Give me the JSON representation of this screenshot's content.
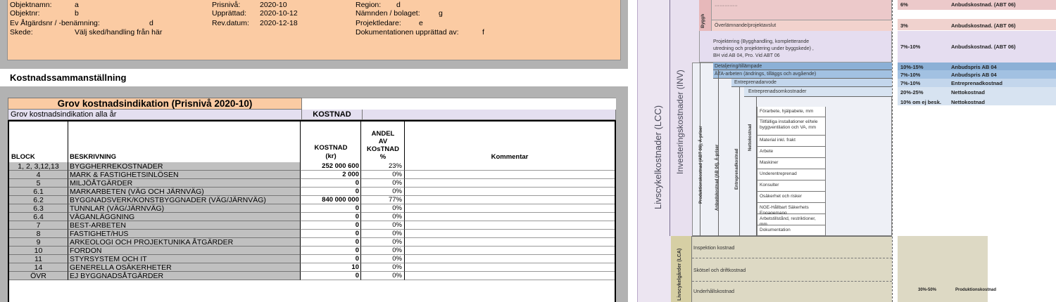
{
  "info": {
    "objektnamn": {
      "label": "Objektnamn:",
      "value": "a"
    },
    "objektnr": {
      "label": "Objektnr:",
      "value": "b"
    },
    "atgardsnr": {
      "label": "Ev Åtgärdsnr / -benämning:",
      "value": "d"
    },
    "skede": {
      "label": "Skede:",
      "value": "Välj sked/handling från här"
    },
    "prisniva": {
      "label": "Prisnivå:",
      "value": "2020-10"
    },
    "upprattad": {
      "label": "Upprättad:",
      "value": "2020-10-12"
    },
    "revdatum": {
      "label": "Rev.datum:",
      "value": "2020-12-18"
    },
    "region": {
      "label": "Region:",
      "value": "d"
    },
    "namnden": {
      "label": "Nämnden / bolaget:",
      "value": "g"
    },
    "projektledare": {
      "label": "Projektledare:",
      "value": "e"
    },
    "dokumentation": {
      "label": "Dokumentationen upprättad av:",
      "value": "f"
    }
  },
  "summary_title": "Kostnadssammanställning",
  "table": {
    "title": "Grov kostnadsindikation  (Prisnivå 2020-10)",
    "subtitle": "Grov kostnadsindikation alla år",
    "kostnad_header": "KOSTNAD",
    "headers": {
      "block": "BLOCK",
      "beskrivning": "BESKRIVNING",
      "kostnad": "KOSTNAD\n(kr)",
      "andel": "ANDEL\nAV\nKOsTNAD\n%",
      "kommentar": "Kommentar"
    },
    "rows": [
      {
        "block": "1, 2, 3,12,13",
        "desc": "BYGGHERREKOSTNADER",
        "cost": "252 000 600",
        "pct": "23%"
      },
      {
        "block": "4",
        "desc": "MARK & FASTIGHETSINLÖSEN",
        "cost": "2 000",
        "pct": "0%"
      },
      {
        "block": "5",
        "desc": "MILJÖÅTGÄRDER",
        "cost": "0",
        "pct": "0%"
      },
      {
        "block": "6.1",
        "desc": "MARKARBETEN (VÄG OCH JÄRNVÄG)",
        "cost": "0",
        "pct": "0%"
      },
      {
        "block": "6.2",
        "desc": "BYGGNADSVERK/KONSTBYGGNADER (VÄG/JÄRNVÄG)",
        "cost": "840 000 000",
        "pct": "77%"
      },
      {
        "block": "6.3",
        "desc": "TUNNLAR (VÄG/JÄRNVÄG)",
        "cost": "0",
        "pct": "0%"
      },
      {
        "block": "6.4",
        "desc": "VÄGANLÄGGNING",
        "cost": "0",
        "pct": "0%"
      },
      {
        "block": "7",
        "desc": "BEST-ARBETEN",
        "cost": "0",
        "pct": "0%"
      },
      {
        "block": "8",
        "desc": "FASTIGHET/HUS",
        "cost": "0",
        "pct": "0%"
      },
      {
        "block": "9",
        "desc": "ARKEOLOGI OCH PROJEKTUNIKA ÅTGÄRDER",
        "cost": "0",
        "pct": "0%"
      },
      {
        "block": "10",
        "desc": "FORDON",
        "cost": "0",
        "pct": "0%"
      },
      {
        "block": "11",
        "desc": "STYRSYSTEM OCH IT",
        "cost": "0",
        "pct": "0%"
      },
      {
        "block": "14",
        "desc": "GENERELLA OSÄKERHETER",
        "cost": "10",
        "pct": "0%"
      },
      {
        "block": "ÖVR",
        "desc": "EJ BYGGNADSÅTGÄRDER",
        "cost": "0",
        "pct": "0%"
      }
    ]
  },
  "diagram": {
    "lcc_label": "Livscykelkostnader (LCC)",
    "inv_label": "Investeringskostnader (INV)",
    "byggh_label": "Byggh",
    "lca_label": "Livscykelgårder (LCA)",
    "produktionskostnad_label": "Produktionskostnad (ABT 06), Á-priser",
    "anbudskostnad_label": "Anbudskostnad (AB 04), Á-priser",
    "entreprenad_label": "Entreprenadkostnad",
    "netto_label": "Nettokostnad",
    "items": [
      "Överlämnande/projektavslut",
      "Projektering (Bygghandling, kompletterande utredning och projektering under byggskede) , BH vid AB 04, Pro. Vid ABT 06",
      "Detaljering/tillämpade",
      "ÄTA-arbeten (ändrings, tilläggs och avgående)",
      "Entreprenadarvode",
      "Entreprenadsomkostnader",
      "Förarbete, hjälpabete, mm",
      "Tillfälliga installationer el/tele byggventilation och VA, mm",
      "Material inkl. frakt",
      "Arbete",
      "Maskiner",
      "Underentreprenad",
      "Konsulter",
      "Osäkerhet och risker",
      "NGE-Hållbart Säkerhets Engagemang",
      "Arbetstillstånd, restriktioner, mm",
      "Dokumentation",
      "Inspektion kostnad",
      "Skötsel och driftkostnad",
      "Underhållskostnad"
    ],
    "pct_rows": [
      {
        "pct": "6%",
        "label": "Anbudskostnad. (ABT 06)"
      },
      {
        "pct": "3%",
        "label": "Anbudskostnad. (ABT 06)"
      },
      {
        "pct": "7%-10%",
        "label": "Anbudskostnad. (ABT 06)"
      },
      {
        "pct": "10%-15%",
        "label": "Anbudspris AB 04"
      },
      {
        "pct": "7%-10%",
        "label": "Anbudspris AB 04"
      },
      {
        "pct": "7%-10%",
        "label": "Entreprenadkostnad"
      },
      {
        "pct": "20%-25%",
        "label": "Nettokostnad"
      },
      {
        "pct": "10% om ej besk.",
        "label": "Nettokostnad"
      },
      {
        "pct": "30%-50%",
        "label": "Produktionskostnad"
      }
    ]
  }
}
